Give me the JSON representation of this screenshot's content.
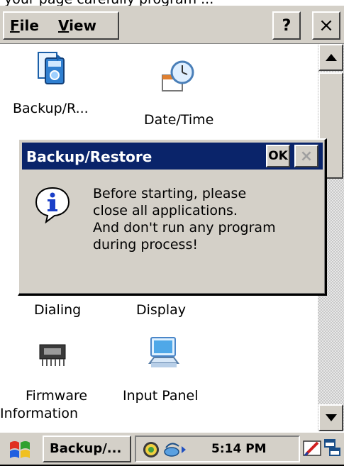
{
  "top_strip_text": "your page carefully program ...",
  "menu": {
    "file_label": "File",
    "file_ul": "F",
    "file_rest": "ile",
    "view_label": "View",
    "view_ul": "V",
    "view_rest": "iew",
    "help_label": "?",
    "close_label": "×"
  },
  "items": [
    {
      "name": "backup-restore",
      "label": "Backup/R...",
      "icon": "backup-restore-icon"
    },
    {
      "name": "date-time",
      "label": "Date/Time",
      "icon": "clock-calendar-icon"
    },
    {
      "name": "dialing",
      "label": "Dialing",
      "icon": "dialing-icon"
    },
    {
      "name": "display",
      "label": "Display",
      "icon": "display-icon"
    },
    {
      "name": "firmware-information",
      "label_line1": "Firmware",
      "label_line2": "Information",
      "icon": "chip-icon"
    },
    {
      "name": "input-panel",
      "label": "Input Panel",
      "icon": "keyboard-icon"
    }
  ],
  "dialog": {
    "title": "Backup/Restore",
    "ok_label": "OK",
    "close_label": "×",
    "icon": "info-icon",
    "message_lines": [
      "Before starting, please",
      "close all applications.",
      "And don't run any program",
      "during process!"
    ]
  },
  "taskbar": {
    "start_icon": "windows-flag-icon",
    "app_button": "Backup/...",
    "clock": "5:14 PM",
    "tray_icons": [
      "network-icon",
      "connection-icon",
      "arrow-icon",
      "input-method-icon",
      "switch-window-icon"
    ]
  },
  "colors": {
    "titlebar": "#0a246a",
    "chrome": "#d4d0c8"
  }
}
